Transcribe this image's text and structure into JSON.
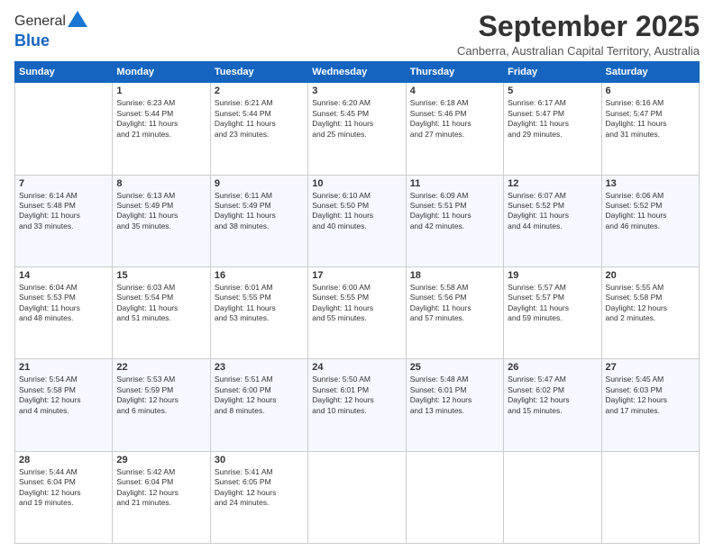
{
  "header": {
    "logo_general": "General",
    "logo_blue": "Blue",
    "month_title": "September 2025",
    "subtitle": "Canberra, Australian Capital Territory, Australia"
  },
  "weekdays": [
    "Sunday",
    "Monday",
    "Tuesday",
    "Wednesday",
    "Thursday",
    "Friday",
    "Saturday"
  ],
  "weeks": [
    [
      {
        "date": "",
        "sunrise": "",
        "sunset": "",
        "daylight": ""
      },
      {
        "date": "1",
        "sunrise": "Sunrise: 6:23 AM",
        "sunset": "Sunset: 5:44 PM",
        "daylight": "Daylight: 11 hours and 21 minutes."
      },
      {
        "date": "2",
        "sunrise": "Sunrise: 6:21 AM",
        "sunset": "Sunset: 5:44 PM",
        "daylight": "Daylight: 11 hours and 23 minutes."
      },
      {
        "date": "3",
        "sunrise": "Sunrise: 6:20 AM",
        "sunset": "Sunset: 5:45 PM",
        "daylight": "Daylight: 11 hours and 25 minutes."
      },
      {
        "date": "4",
        "sunrise": "Sunrise: 6:18 AM",
        "sunset": "Sunset: 5:46 PM",
        "daylight": "Daylight: 11 hours and 27 minutes."
      },
      {
        "date": "5",
        "sunrise": "Sunrise: 6:17 AM",
        "sunset": "Sunset: 5:47 PM",
        "daylight": "Daylight: 11 hours and 29 minutes."
      },
      {
        "date": "6",
        "sunrise": "Sunrise: 6:16 AM",
        "sunset": "Sunset: 5:47 PM",
        "daylight": "Daylight: 11 hours and 31 minutes."
      }
    ],
    [
      {
        "date": "7",
        "sunrise": "Sunrise: 6:14 AM",
        "sunset": "Sunset: 5:48 PM",
        "daylight": "Daylight: 11 hours and 33 minutes."
      },
      {
        "date": "8",
        "sunrise": "Sunrise: 6:13 AM",
        "sunset": "Sunset: 5:49 PM",
        "daylight": "Daylight: 11 hours and 35 minutes."
      },
      {
        "date": "9",
        "sunrise": "Sunrise: 6:11 AM",
        "sunset": "Sunset: 5:49 PM",
        "daylight": "Daylight: 11 hours and 38 minutes."
      },
      {
        "date": "10",
        "sunrise": "Sunrise: 6:10 AM",
        "sunset": "Sunset: 5:50 PM",
        "daylight": "Daylight: 11 hours and 40 minutes."
      },
      {
        "date": "11",
        "sunrise": "Sunrise: 6:09 AM",
        "sunset": "Sunset: 5:51 PM",
        "daylight": "Daylight: 11 hours and 42 minutes."
      },
      {
        "date": "12",
        "sunrise": "Sunrise: 6:07 AM",
        "sunset": "Sunset: 5:52 PM",
        "daylight": "Daylight: 11 hours and 44 minutes."
      },
      {
        "date": "13",
        "sunrise": "Sunrise: 6:06 AM",
        "sunset": "Sunset: 5:52 PM",
        "daylight": "Daylight: 11 hours and 46 minutes."
      }
    ],
    [
      {
        "date": "14",
        "sunrise": "Sunrise: 6:04 AM",
        "sunset": "Sunset: 5:53 PM",
        "daylight": "Daylight: 11 hours and 48 minutes."
      },
      {
        "date": "15",
        "sunrise": "Sunrise: 6:03 AM",
        "sunset": "Sunset: 5:54 PM",
        "daylight": "Daylight: 11 hours and 51 minutes."
      },
      {
        "date": "16",
        "sunrise": "Sunrise: 6:01 AM",
        "sunset": "Sunset: 5:55 PM",
        "daylight": "Daylight: 11 hours and 53 minutes."
      },
      {
        "date": "17",
        "sunrise": "Sunrise: 6:00 AM",
        "sunset": "Sunset: 5:55 PM",
        "daylight": "Daylight: 11 hours and 55 minutes."
      },
      {
        "date": "18",
        "sunrise": "Sunrise: 5:58 AM",
        "sunset": "Sunset: 5:56 PM",
        "daylight": "Daylight: 11 hours and 57 minutes."
      },
      {
        "date": "19",
        "sunrise": "Sunrise: 5:57 AM",
        "sunset": "Sunset: 5:57 PM",
        "daylight": "Daylight: 11 hours and 59 minutes."
      },
      {
        "date": "20",
        "sunrise": "Sunrise: 5:55 AM",
        "sunset": "Sunset: 5:58 PM",
        "daylight": "Daylight: 12 hours and 2 minutes."
      }
    ],
    [
      {
        "date": "21",
        "sunrise": "Sunrise: 5:54 AM",
        "sunset": "Sunset: 5:58 PM",
        "daylight": "Daylight: 12 hours and 4 minutes."
      },
      {
        "date": "22",
        "sunrise": "Sunrise: 5:53 AM",
        "sunset": "Sunset: 5:59 PM",
        "daylight": "Daylight: 12 hours and 6 minutes."
      },
      {
        "date": "23",
        "sunrise": "Sunrise: 5:51 AM",
        "sunset": "Sunset: 6:00 PM",
        "daylight": "Daylight: 12 hours and 8 minutes."
      },
      {
        "date": "24",
        "sunrise": "Sunrise: 5:50 AM",
        "sunset": "Sunset: 6:01 PM",
        "daylight": "Daylight: 12 hours and 10 minutes."
      },
      {
        "date": "25",
        "sunrise": "Sunrise: 5:48 AM",
        "sunset": "Sunset: 6:01 PM",
        "daylight": "Daylight: 12 hours and 13 minutes."
      },
      {
        "date": "26",
        "sunrise": "Sunrise: 5:47 AM",
        "sunset": "Sunset: 6:02 PM",
        "daylight": "Daylight: 12 hours and 15 minutes."
      },
      {
        "date": "27",
        "sunrise": "Sunrise: 5:45 AM",
        "sunset": "Sunset: 6:03 PM",
        "daylight": "Daylight: 12 hours and 17 minutes."
      }
    ],
    [
      {
        "date": "28",
        "sunrise": "Sunrise: 5:44 AM",
        "sunset": "Sunset: 6:04 PM",
        "daylight": "Daylight: 12 hours and 19 minutes."
      },
      {
        "date": "29",
        "sunrise": "Sunrise: 5:42 AM",
        "sunset": "Sunset: 6:04 PM",
        "daylight": "Daylight: 12 hours and 21 minutes."
      },
      {
        "date": "30",
        "sunrise": "Sunrise: 5:41 AM",
        "sunset": "Sunset: 6:05 PM",
        "daylight": "Daylight: 12 hours and 24 minutes."
      },
      {
        "date": "",
        "sunrise": "",
        "sunset": "",
        "daylight": ""
      },
      {
        "date": "",
        "sunrise": "",
        "sunset": "",
        "daylight": ""
      },
      {
        "date": "",
        "sunrise": "",
        "sunset": "",
        "daylight": ""
      },
      {
        "date": "",
        "sunrise": "",
        "sunset": "",
        "daylight": ""
      }
    ]
  ]
}
